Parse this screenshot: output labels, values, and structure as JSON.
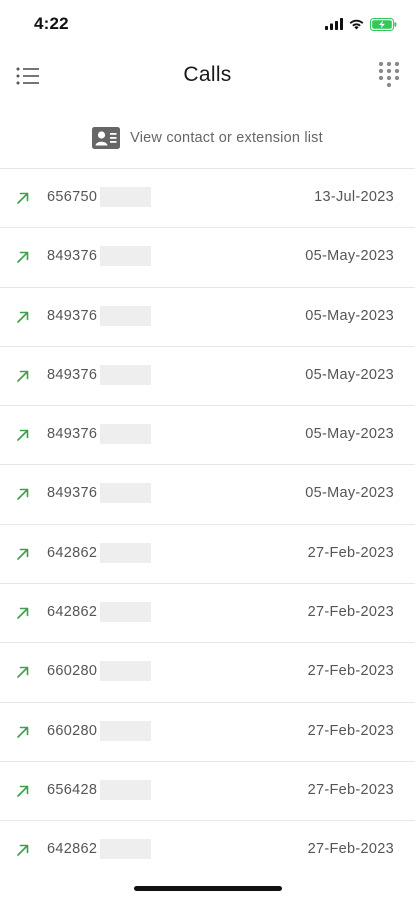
{
  "status_bar": {
    "time": "4:22"
  },
  "header": {
    "title": "Calls"
  },
  "contact_link": {
    "label": "View contact or extension list"
  },
  "calls": [
    {
      "number": "656750",
      "date": "13-Jul-2023",
      "direction": "outgoing"
    },
    {
      "number": "849376",
      "date": "05-May-2023",
      "direction": "outgoing"
    },
    {
      "number": "849376",
      "date": "05-May-2023",
      "direction": "outgoing"
    },
    {
      "number": "849376",
      "date": "05-May-2023",
      "direction": "outgoing"
    },
    {
      "number": "849376",
      "date": "05-May-2023",
      "direction": "outgoing"
    },
    {
      "number": "849376",
      "date": "05-May-2023",
      "direction": "outgoing"
    },
    {
      "number": "642862",
      "date": "27-Feb-2023",
      "direction": "outgoing"
    },
    {
      "number": "642862",
      "date": "27-Feb-2023",
      "direction": "outgoing"
    },
    {
      "number": "660280",
      "date": "27-Feb-2023",
      "direction": "outgoing"
    },
    {
      "number": "660280",
      "date": "27-Feb-2023",
      "direction": "outgoing"
    },
    {
      "number": "656428",
      "date": "27-Feb-2023",
      "direction": "outgoing"
    },
    {
      "number": "642862",
      "date": "27-Feb-2023",
      "direction": "outgoing"
    }
  ],
  "colors": {
    "outgoing_arrow": "#3aa14a",
    "battery": "#34c759",
    "divider": "#e6e6e6"
  },
  "icons": {
    "menu": "list-menu-icon",
    "dialpad": "dialpad-icon",
    "contact": "contact-card-icon",
    "outgoing": "outgoing-call-arrow-icon"
  }
}
